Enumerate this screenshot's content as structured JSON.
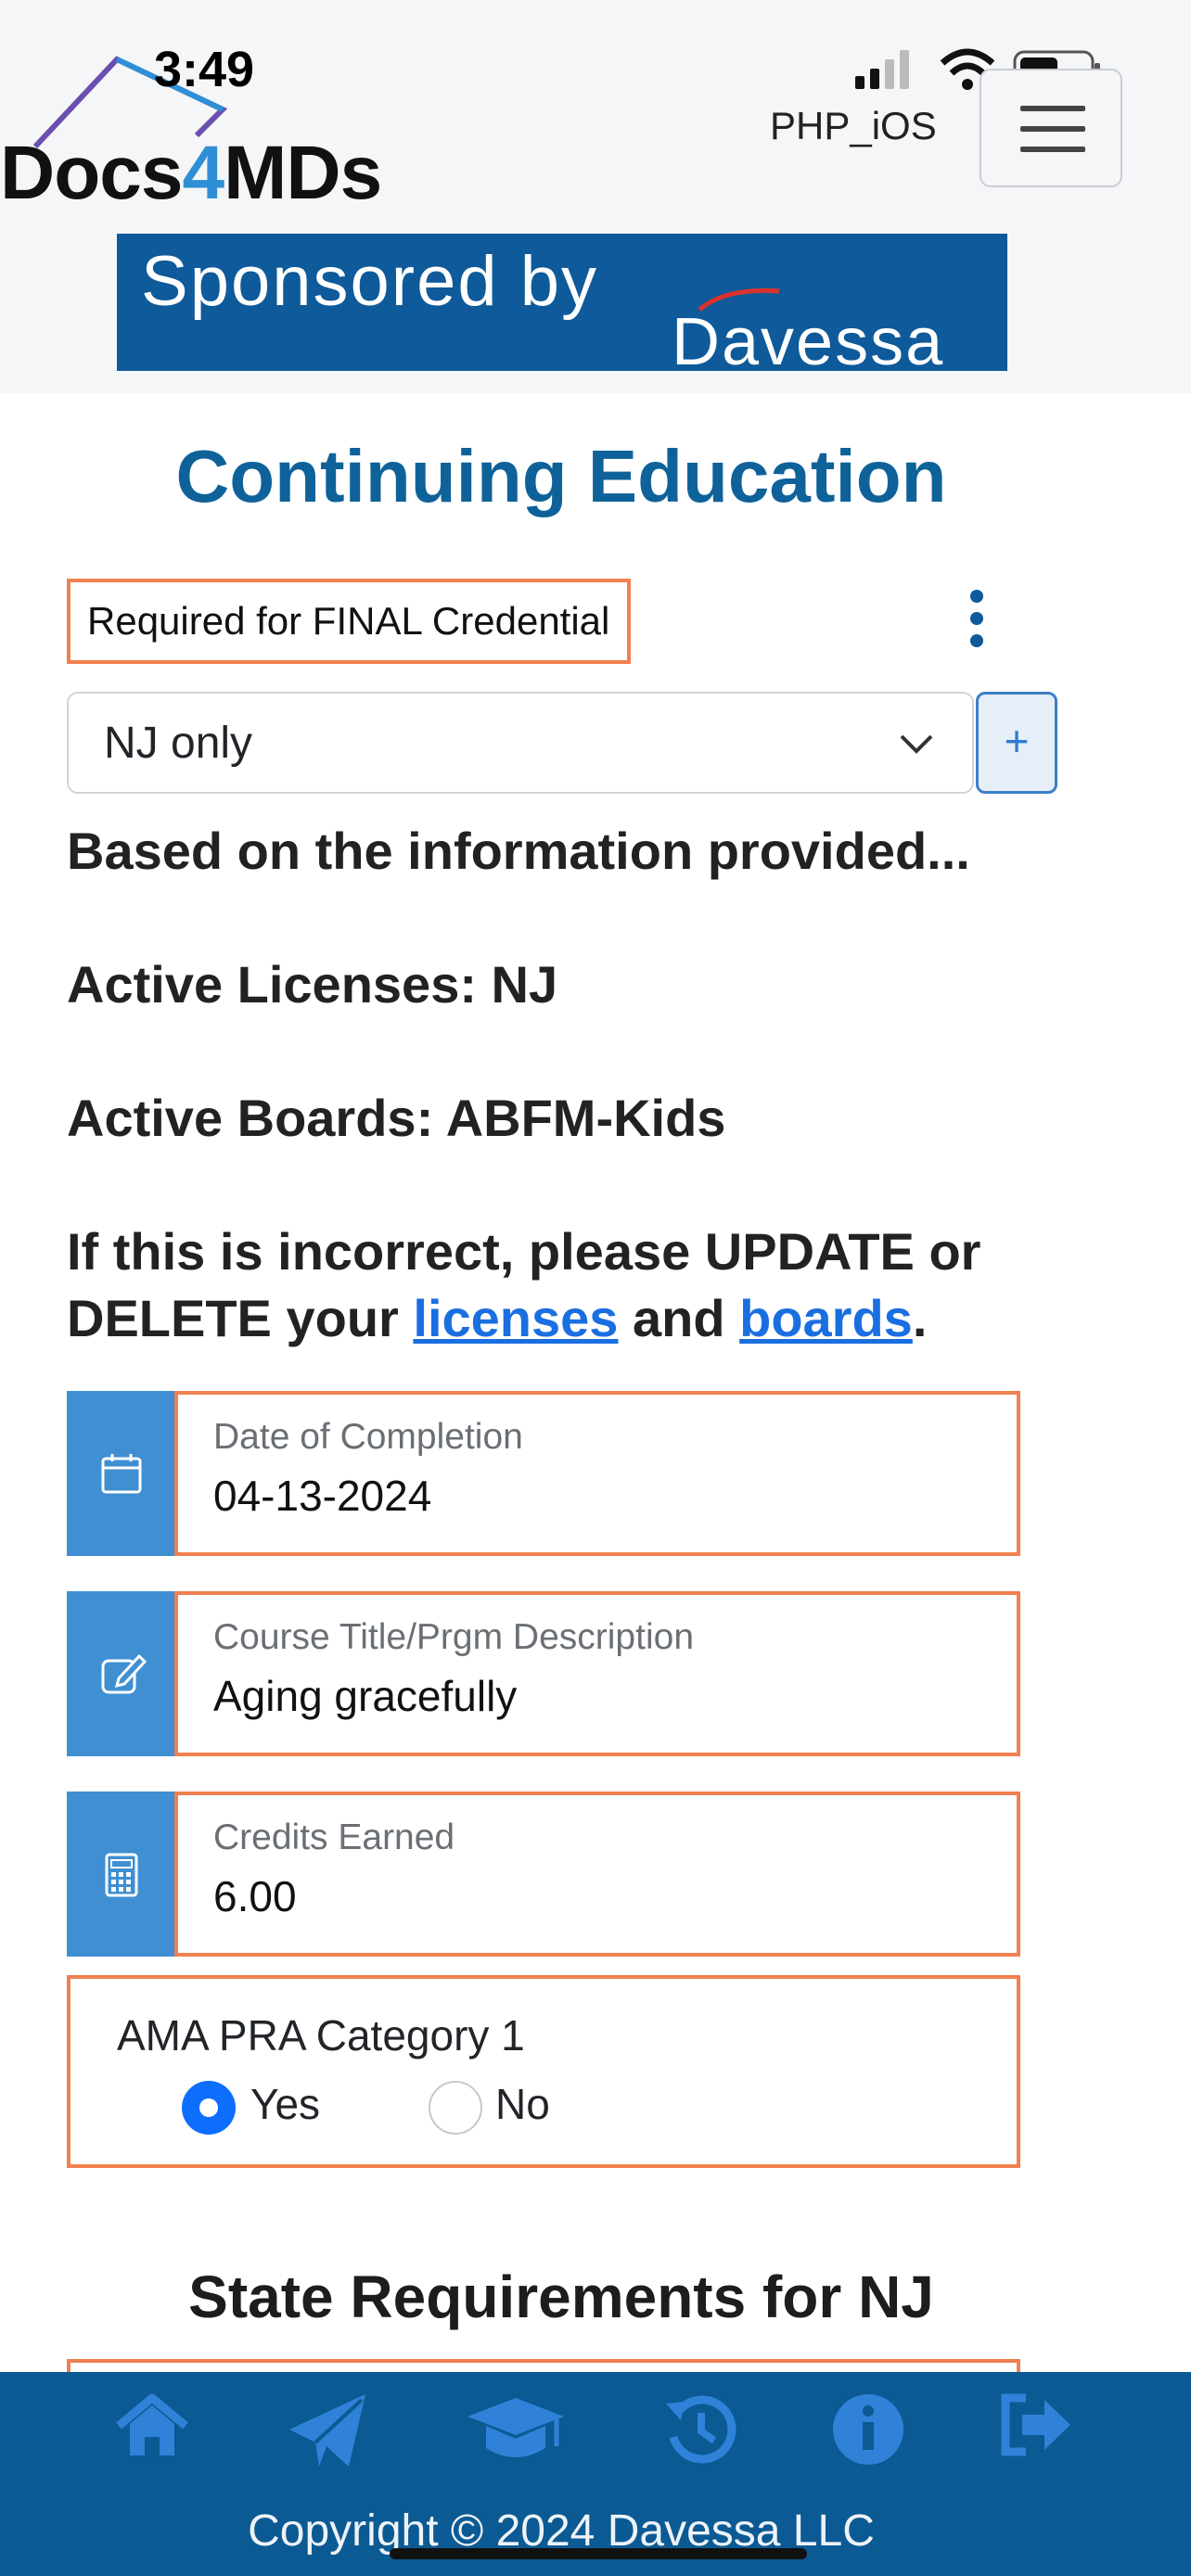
{
  "status_bar": {
    "time": "3:49",
    "carrier": "PHP_iOS"
  },
  "brand": {
    "name_prefix": "Docs",
    "name_highlight": "4",
    "name_suffix": "MDs",
    "accent_color": "#2f8fd6"
  },
  "sponsor": {
    "line1": "Sponsored by",
    "line2": "Davessa",
    "bg_color": "#0e5a9a"
  },
  "page": {
    "title": "Continuing Education"
  },
  "requirement_tag": "Required for FINAL Credential",
  "filter": {
    "selected": "NJ only",
    "add_label": "+"
  },
  "info": {
    "intro": "Based on the information provided...",
    "licenses": "Active Licenses: NJ",
    "boards": "Active Boards: ABFM-Kids",
    "prompt_start": "If this is incorrect, please UPDATE or",
    "prompt_delete": "DELETE your",
    "link_licenses": "licenses",
    "word_and": "and",
    "link_boards": "boards",
    "period": "."
  },
  "fields": {
    "date": {
      "label": "Date of Completion",
      "value": "04-13-2024",
      "icon": "calendar-icon"
    },
    "course": {
      "label": "Course Title/Prgm Description",
      "value": "Aging gracefully",
      "icon": "edit-icon"
    },
    "credits": {
      "label": "Credits Earned",
      "value": "6.00",
      "icon": "calculator-icon"
    }
  },
  "ama": {
    "question": "AMA PRA Category 1",
    "yes": "Yes",
    "no": "No",
    "selected": "Yes"
  },
  "state_requirements": {
    "title": "State Requirements for NJ"
  },
  "footer": {
    "nav": [
      "home-icon",
      "paper-plane-icon",
      "graduation-cap-icon",
      "history-icon",
      "info-icon",
      "sign-out-icon"
    ],
    "copyright": "Copyright © 2024 Davessa LLC",
    "icon_color": "#2f82d8"
  },
  "colors": {
    "title_blue": "#0e6299",
    "highlight_border": "#f08050",
    "icon_cell": "#3f8fd2",
    "footer_bg": "#0b5a93"
  }
}
